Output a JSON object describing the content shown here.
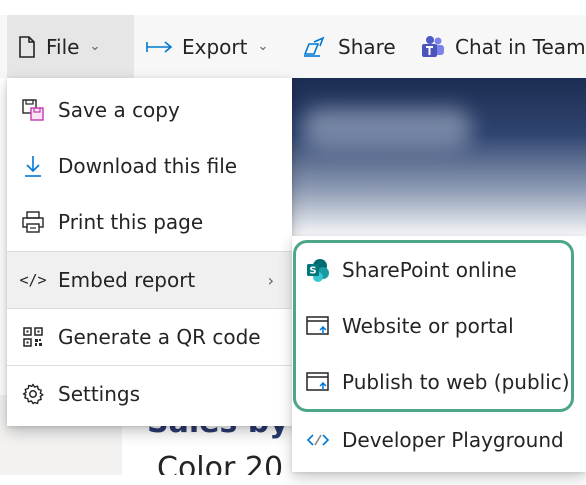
{
  "toolbar": {
    "file_label": "File",
    "export_label": "Export",
    "share_label": "Share",
    "chat_label": "Chat in Teams"
  },
  "file_menu": {
    "items": [
      {
        "label": "Save a copy",
        "icon": "save-copy-icon"
      },
      {
        "label": "Download this file",
        "icon": "download-icon"
      },
      {
        "label": "Print this page",
        "icon": "print-icon"
      },
      {
        "label": "Embed report",
        "icon": "embed-code-icon"
      },
      {
        "label": "Generate a QR code",
        "icon": "qr-code-icon"
      },
      {
        "label": "Settings",
        "icon": "gear-icon"
      }
    ]
  },
  "embed_submenu": {
    "items": [
      {
        "label": "SharePoint online",
        "icon": "sharepoint-icon"
      },
      {
        "label": "Website or portal",
        "icon": "website-embed-icon"
      },
      {
        "label": "Publish to web (public)",
        "icon": "publish-web-icon"
      },
      {
        "label": "Developer Playground",
        "icon": "developer-icon"
      }
    ]
  },
  "report": {
    "title_fragment": "Sales by C",
    "subtitle_fragment": "Color   20"
  },
  "colors": {
    "highlight": "#4da58a",
    "sharepoint": "#038387",
    "teams": "#5059c9",
    "accent_blue": "#0078d4"
  }
}
